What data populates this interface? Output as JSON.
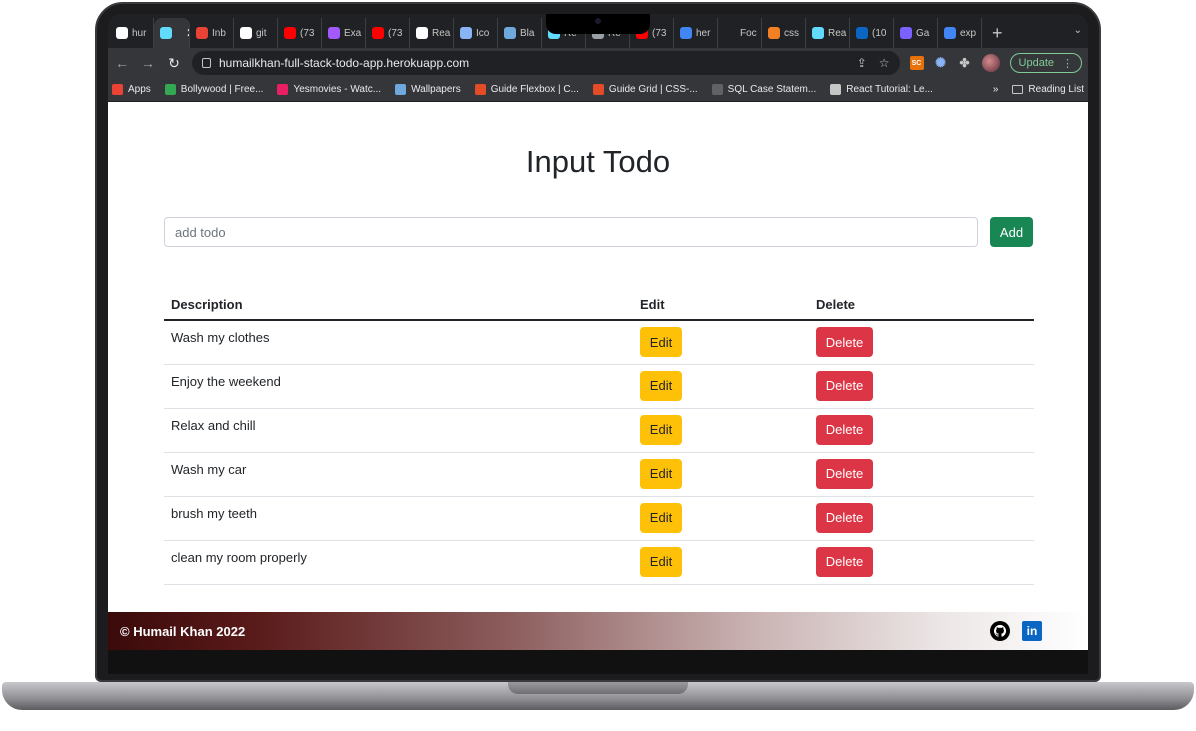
{
  "browser": {
    "tabs": [
      {
        "label": "hur",
        "icon": "github-icon",
        "color": "#ffffff"
      },
      {
        "label": "",
        "icon": "react-icon",
        "color": "#61dafb",
        "active": true
      },
      {
        "label": "Inb",
        "icon": "gmail-icon",
        "color": "#ea4335"
      },
      {
        "label": "git",
        "icon": "github-icon",
        "color": "#ffffff"
      },
      {
        "label": "(73",
        "icon": "youtube-icon",
        "color": "#ff0000"
      },
      {
        "label": "Exa",
        "icon": "figma-icon",
        "color": "#a259ff"
      },
      {
        "label": "(73",
        "icon": "youtube-icon",
        "color": "#ff0000"
      },
      {
        "label": "Rea",
        "icon": "globe-icon",
        "color": "#ffffff"
      },
      {
        "label": "Ico",
        "icon": "flag-icon",
        "color": "#8ab4f8"
      },
      {
        "label": "Bla",
        "icon": "w-icon",
        "color": "#6fa8dc"
      },
      {
        "label": "Re",
        "icon": "react-icon",
        "color": "#61dafb"
      },
      {
        "label": "Re",
        "icon": "square-icon",
        "color": "#9aa0a6"
      },
      {
        "label": "(73",
        "icon": "youtube-icon",
        "color": "#ff0000"
      },
      {
        "label": "her",
        "icon": "google-icon",
        "color": "#4285f4"
      },
      {
        "label": "Foc",
        "icon": "blank-icon",
        "color": "#202124"
      },
      {
        "label": "css",
        "icon": "stack-icon",
        "color": "#f48024"
      },
      {
        "label": "Rea",
        "icon": "react-icon",
        "color": "#61dafb"
      },
      {
        "label": "(10",
        "icon": "linkedin-icon",
        "color": "#0a66c2"
      },
      {
        "label": "Ga",
        "icon": "g-circle-icon",
        "color": "#7b61ff"
      },
      {
        "label": "exp",
        "icon": "google-icon",
        "color": "#4285f4"
      }
    ],
    "close_glyph": "✕",
    "new_tab_glyph": "+",
    "tab_menu_glyph": "⌄",
    "url": "humailkhan-full-stack-todo-app.herokuapp.com",
    "update_label": "Update",
    "bookmarks": [
      {
        "label": "Apps",
        "icon": "apps-grid-icon",
        "color": "#ea4335"
      },
      {
        "label": "Bollywood | Free...",
        "icon": "play-icon",
        "color": "#34a853"
      },
      {
        "label": "Yesmovies - Watc...",
        "icon": "ym-icon",
        "color": "#e91e63"
      },
      {
        "label": "Wallpapers",
        "icon": "w-icon",
        "color": "#6fa8dc"
      },
      {
        "label": "Guide Flexbox | C...",
        "icon": "asterisk-icon",
        "color": "#e34c26"
      },
      {
        "label": "Guide Grid | CSS-...",
        "icon": "asterisk-icon",
        "color": "#e34c26"
      },
      {
        "label": "SQL Case Statem...",
        "icon": "db-icon",
        "color": "#5f6368"
      },
      {
        "label": "React Tutorial: Le...",
        "icon": "bars-icon",
        "color": "#c4c7c5"
      }
    ],
    "bookmarks_more": "»",
    "reading_list": "Reading List"
  },
  "page": {
    "title": "Input Todo",
    "input_placeholder": "add todo",
    "add_label": "Add",
    "table": {
      "headers": [
        "Description",
        "Edit",
        "Delete"
      ],
      "rows": [
        {
          "description": "Wash my clothes",
          "edit": "Edit",
          "delete": "Delete"
        },
        {
          "description": "Enjoy the weekend",
          "edit": "Edit",
          "delete": "Delete"
        },
        {
          "description": "Relax and chill",
          "edit": "Edit",
          "delete": "Delete"
        },
        {
          "description": "Wash my car",
          "edit": "Edit",
          "delete": "Delete"
        },
        {
          "description": "brush my teeth",
          "edit": "Edit",
          "delete": "Delete"
        },
        {
          "description": "clean my room properly",
          "edit": "Edit",
          "delete": "Delete"
        }
      ]
    },
    "footer": {
      "copyright": "© Humail Khan 2022",
      "linkedin_glyph": "in"
    }
  },
  "colors": {
    "add_button": "#198754",
    "edit_button": "#ffc107",
    "delete_button": "#dc3545"
  }
}
